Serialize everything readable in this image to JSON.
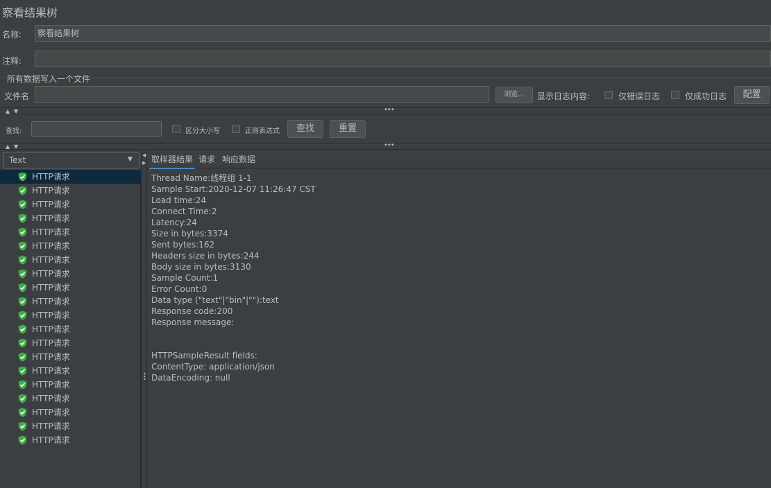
{
  "window": {
    "title": "察看结果树"
  },
  "form": {
    "name_label": "名称:",
    "name_value": "察看结果树",
    "comment_label": "注释:",
    "comment_value": ""
  },
  "file_section": {
    "legend": "所有数据写入一个文件",
    "filename_label": "文件名",
    "filename_value": "",
    "browse_button": "浏览...",
    "log_label": "显示日志内容:",
    "errors_only_label": "仅错误日志",
    "success_only_label": "仅成功日志",
    "configure_button": "配置"
  },
  "search": {
    "label": "查找:",
    "value": "",
    "case_sensitive_label": "区分大小写",
    "regex_label": "正则表达式",
    "find_button": "查找",
    "reset_button": "重置"
  },
  "renderer": {
    "selected": "Text"
  },
  "tree": {
    "items": [
      {
        "label": "HTTP请求",
        "selected": true
      },
      {
        "label": "HTTP请求"
      },
      {
        "label": "HTTP请求"
      },
      {
        "label": "HTTP请求"
      },
      {
        "label": "HTTP请求"
      },
      {
        "label": "HTTP请求"
      },
      {
        "label": "HTTP请求"
      },
      {
        "label": "HTTP请求"
      },
      {
        "label": "HTTP请求"
      },
      {
        "label": "HTTP请求"
      },
      {
        "label": "HTTP请求"
      },
      {
        "label": "HTTP请求"
      },
      {
        "label": "HTTP请求"
      },
      {
        "label": "HTTP请求"
      },
      {
        "label": "HTTP请求"
      },
      {
        "label": "HTTP请求"
      },
      {
        "label": "HTTP请求"
      },
      {
        "label": "HTTP请求"
      },
      {
        "label": "HTTP请求"
      },
      {
        "label": "HTTP请求"
      }
    ]
  },
  "tabs": [
    {
      "label": "取样器结果",
      "active": true
    },
    {
      "label": "请求"
    },
    {
      "label": "响应数据"
    }
  ],
  "result": {
    "lines": [
      "Thread Name:线程组 1-1",
      "Sample Start:2020-12-07 11:26:47 CST",
      "Load time:24",
      "Connect Time:2",
      "Latency:24",
      "Size in bytes:3374",
      "Sent bytes:162",
      "Headers size in bytes:244",
      "Body size in bytes:3130",
      "Sample Count:1",
      "Error Count:0",
      "Data type (\"text\"|\"bin\"|\"\"):text",
      "Response code:200",
      "Response message:",
      "",
      "",
      "HTTPSampleResult fields:",
      "ContentType: application/json",
      "DataEncoding: null"
    ]
  },
  "colors": {
    "background": "#3c3f41",
    "field": "#45494a",
    "selection": "#0d293e",
    "success_icon": "#3fae49",
    "tab_underline": "#4a88c7"
  }
}
